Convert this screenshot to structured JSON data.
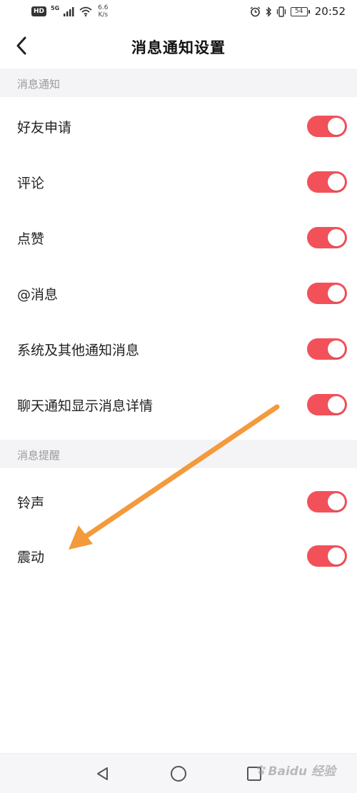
{
  "status_bar": {
    "hd": "HD",
    "network": "5G",
    "speed_value": "6.6",
    "speed_unit": "K/s",
    "battery": "54",
    "time": "20:52"
  },
  "header": {
    "title": "消息通知设置"
  },
  "sections": [
    {
      "title": "消息通知",
      "items": [
        {
          "label": "好友申请",
          "enabled": true
        },
        {
          "label": "评论",
          "enabled": true
        },
        {
          "label": "点赞",
          "enabled": true
        },
        {
          "label": "@消息",
          "enabled": true
        },
        {
          "label": "系统及其他通知消息",
          "enabled": true
        },
        {
          "label": "聊天通知显示消息详情",
          "enabled": true
        }
      ]
    },
    {
      "title": "消息提醒",
      "items": [
        {
          "label": "铃声",
          "enabled": true
        },
        {
          "label": "震动",
          "enabled": true
        }
      ]
    }
  ],
  "watermark": {
    "text": "Baidu 经验"
  },
  "colors": {
    "toggle_on": "#f2515a",
    "annotation_arrow": "#f39a3c",
    "section_bg": "#f4f4f6"
  },
  "icons": {
    "back": "chevron-left-icon",
    "nav_back": "triangle-back-icon",
    "nav_home": "circle-home-icon",
    "nav_recents": "square-recents-icon"
  }
}
